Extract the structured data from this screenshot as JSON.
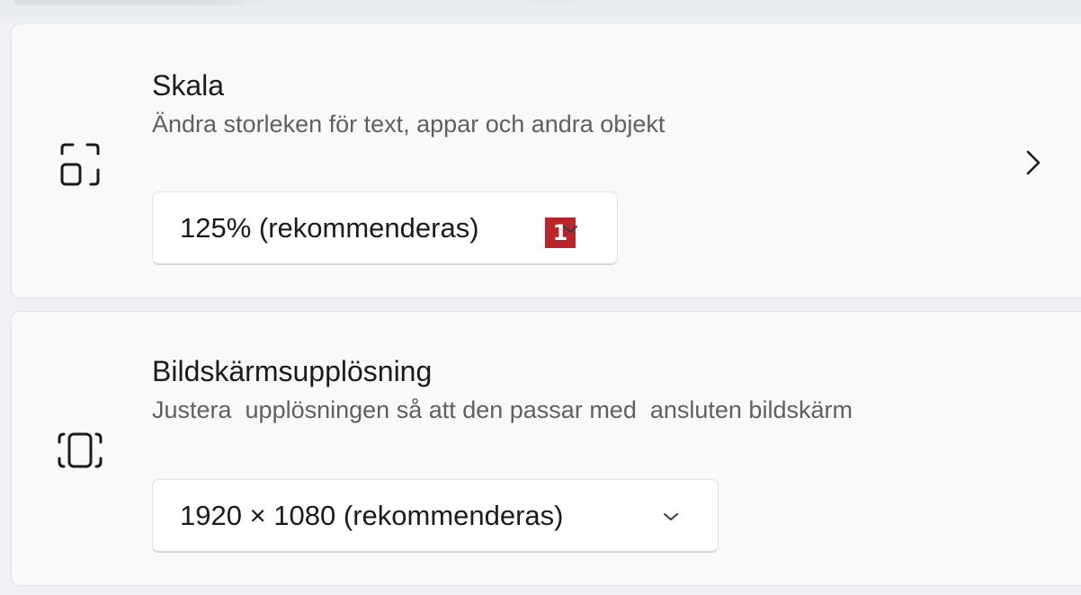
{
  "scale_card": {
    "title": "Skala",
    "description": "Ändra storleken för text, appar och andra objekt",
    "icon": "scale-icon",
    "dropdown_value": "125% (rekommenderas)",
    "marker_label": "1"
  },
  "resolution_card": {
    "title": "Bildskärmsupplösning",
    "description": "Justera  upplösningen så att den passar med  ansluten bildskärm",
    "icon": "display-resolution-icon",
    "dropdown_value": "1920 × 1080 (rekommenderas)"
  },
  "colors": {
    "background": "#eef0f3",
    "card": "#f9f9f9",
    "marker": "#b8262b",
    "text_primary": "#1b1b1b",
    "text_secondary": "#606060"
  }
}
